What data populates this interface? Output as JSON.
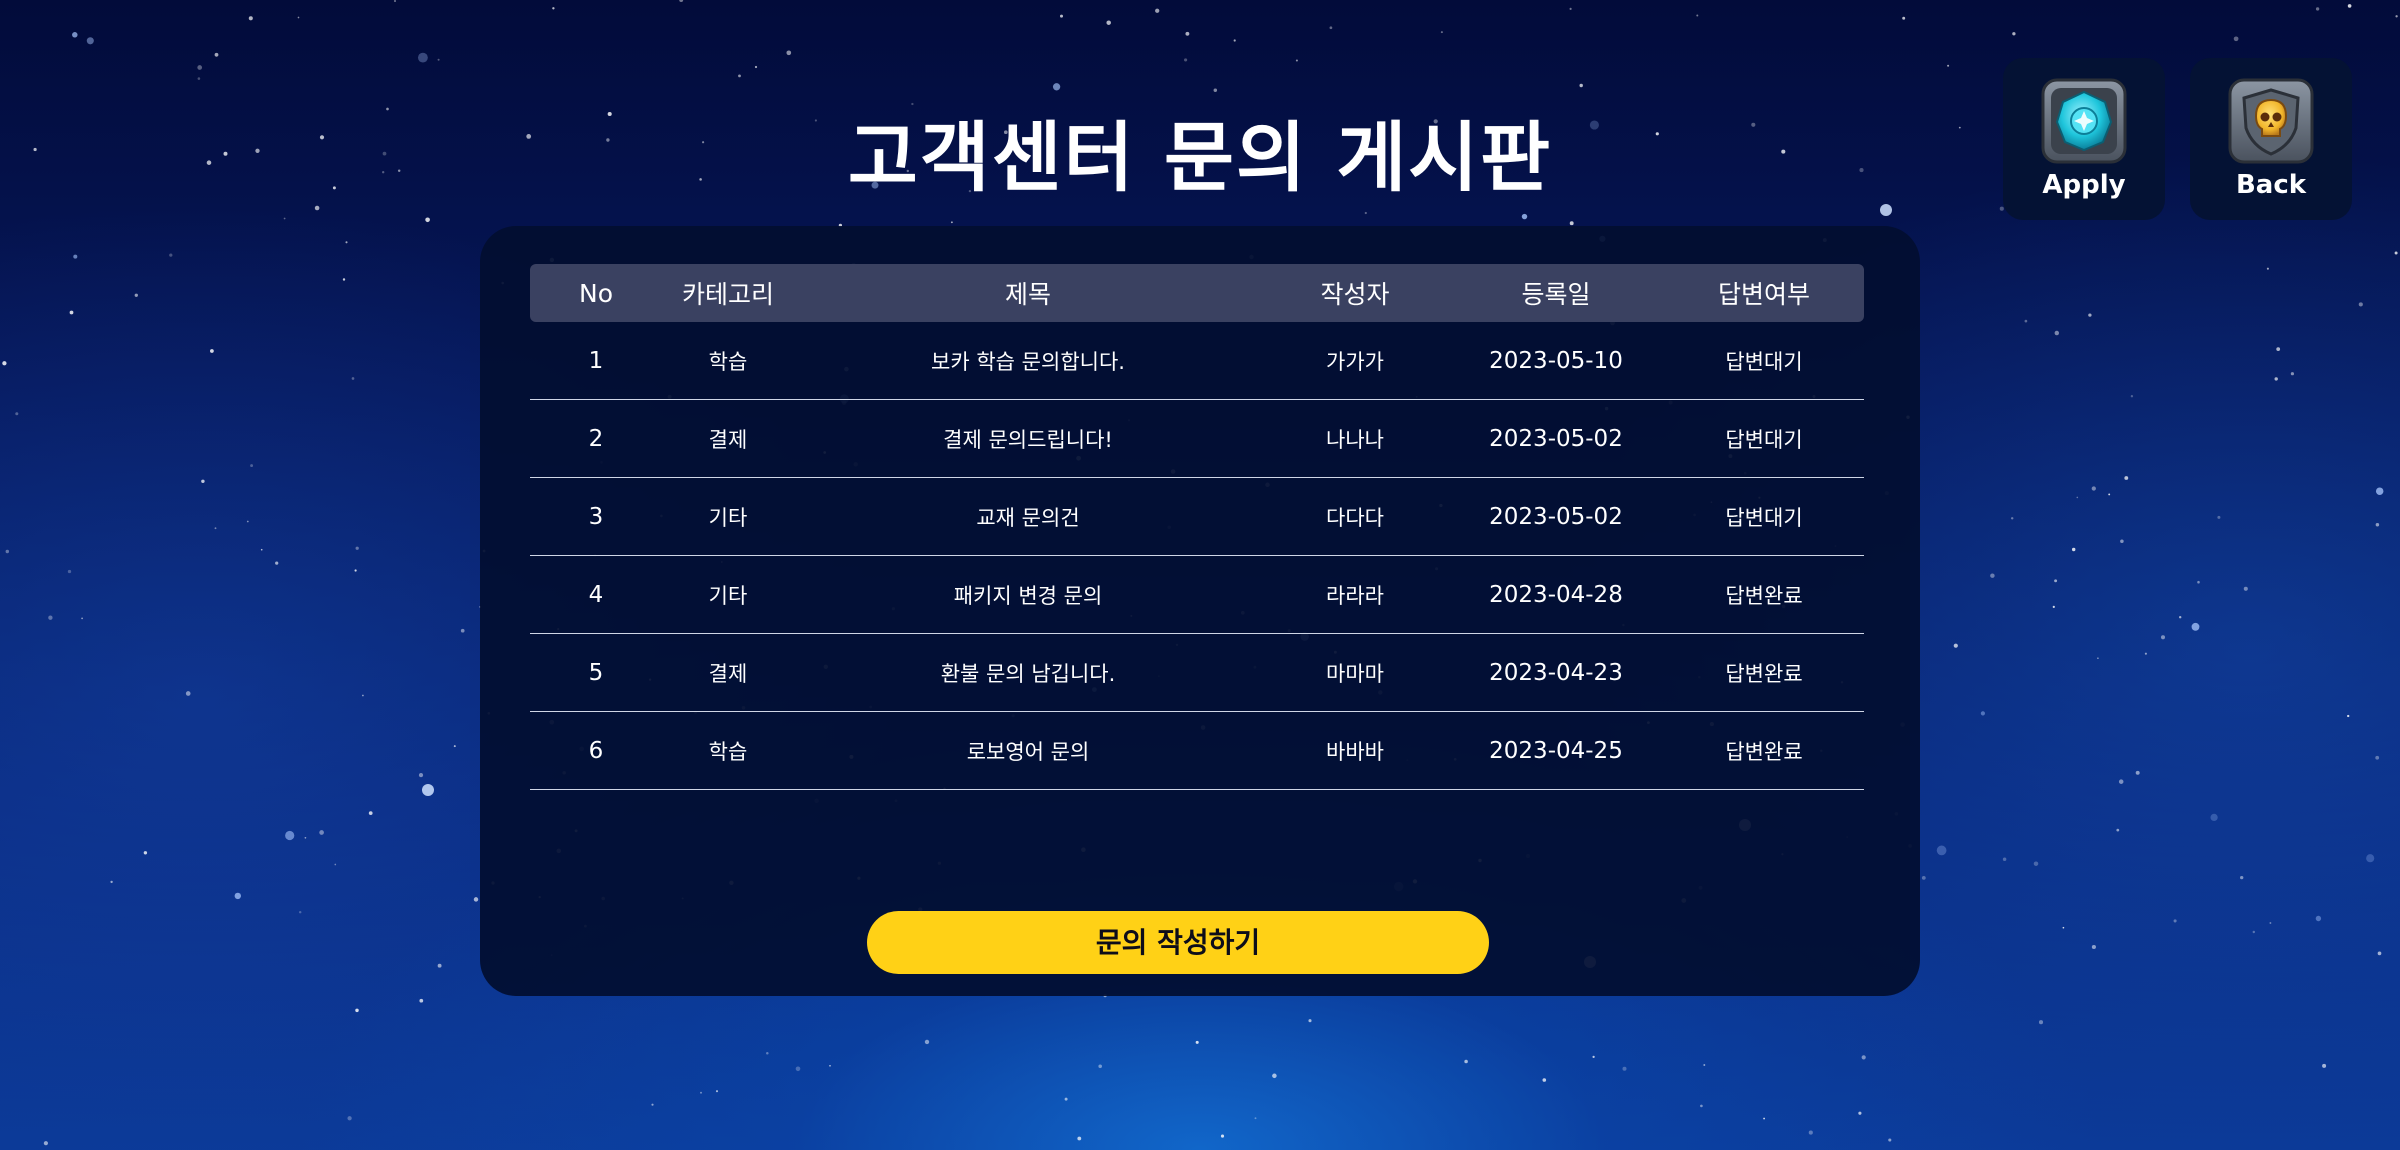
{
  "page": {
    "title": "고객센터 문의 게시판"
  },
  "header_buttons": {
    "apply": {
      "label": "Apply",
      "icon": "gem-shield-icon",
      "color": "#1fc6dc"
    },
    "back": {
      "label": "Back",
      "icon": "skull-shield-icon",
      "color": "#f2b62b"
    }
  },
  "table": {
    "columns": [
      "No",
      "카테고리",
      "제목",
      "작성자",
      "등록일",
      "답변여부"
    ],
    "rows": [
      {
        "no": "1",
        "category": "학습",
        "title": "보카 학습 문의합니다.",
        "author": "가가가",
        "date": "2023-05-10",
        "status": "답변대기"
      },
      {
        "no": "2",
        "category": "결제",
        "title": "결제 문의드립니다!",
        "author": "나나나",
        "date": "2023-05-02",
        "status": "답변대기"
      },
      {
        "no": "3",
        "category": "기타",
        "title": "교재 문의건",
        "author": "다다다",
        "date": "2023-05-02",
        "status": "답변대기"
      },
      {
        "no": "4",
        "category": "기타",
        "title": "패키지 변경 문의",
        "author": "라라라",
        "date": "2023-04-28",
        "status": "답변완료"
      },
      {
        "no": "5",
        "category": "결제",
        "title": "환불 문의 남깁니다.",
        "author": "마마마",
        "date": "2023-04-23",
        "status": "답변완료"
      },
      {
        "no": "6",
        "category": "학습",
        "title": "로보영어 문의",
        "author": "바바바",
        "date": "2023-04-25",
        "status": "답변완료"
      }
    ]
  },
  "actions": {
    "write_label": "문의 작성하기"
  },
  "colors": {
    "accent_button": "#ffd116",
    "panel": "#020e30",
    "header_row": "#3a4161"
  }
}
